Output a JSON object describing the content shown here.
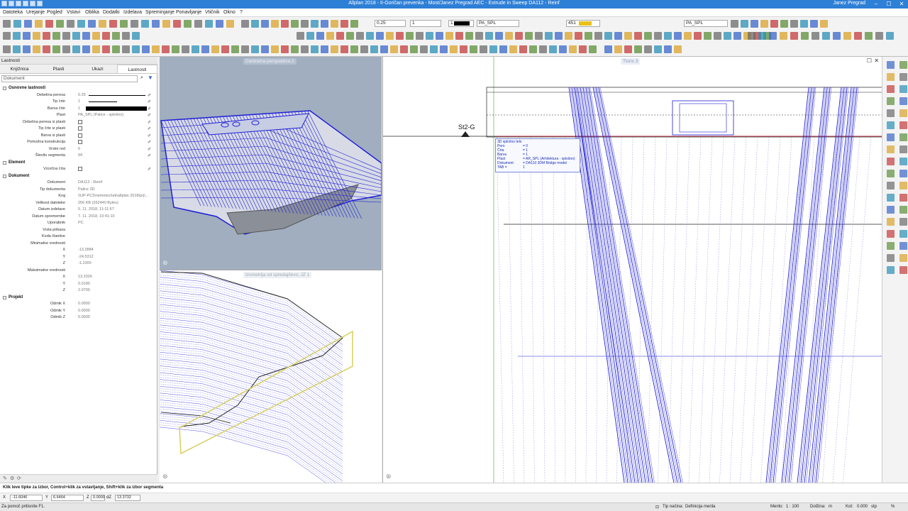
{
  "window": {
    "title": "Allplan 2018 - II-Goričan prevenka - Most/Janez Pregrad AEC - Extrude in Sweep DA112 - Reinf",
    "user": "Janez Pregrad",
    "min_glyph": "–",
    "max_glyph": "☐",
    "close_glyph": "✕"
  },
  "menu": [
    "Datoteka",
    "Urejanje",
    "Pogled",
    "Vstavi",
    "Oblika",
    "Dodatki",
    "Izdelava",
    "Spreminjanje",
    "Ponavljanje",
    "Vtičnik",
    "Okno",
    "?"
  ],
  "toolbar": {
    "pen_value": "0.25",
    "line_value": "1",
    "color_value": "1",
    "layer_value": "PA_SPL",
    "segment_value": "451",
    "layer2_value": "PA_SPL"
  },
  "panel": {
    "title": "Lastnosti",
    "tabs": [
      "Knjižnica",
      "Plasti",
      "Ukazi",
      "Lastnosti"
    ],
    "active_tab": "Lastnosti",
    "doc_combo": "Dokument",
    "sections": {
      "basic": "Osnovne lastnosti",
      "element": "Element",
      "document": "Dokument",
      "project": "Projekt"
    },
    "basic_rows": [
      {
        "label": "Debelina peresa",
        "value": "0.25"
      },
      {
        "label": "Tip črte",
        "value": "1"
      },
      {
        "label": "Barva črte",
        "value": "1"
      },
      {
        "label": "Plast",
        "value": "PA_SPL (Palice - splošno)"
      },
      {
        "label": "Debelina peresa iz plasti",
        "value": ""
      },
      {
        "label": "Tip črte iz plasti",
        "value": ""
      },
      {
        "label": "Barva iz plasti",
        "value": ""
      },
      {
        "label": "Pomožna konstrukcija",
        "value": ""
      },
      {
        "label": "Vrstni red",
        "value": "0"
      },
      {
        "label": "Število segmenta",
        "value": "94"
      }
    ],
    "element_rows": [
      {
        "label": "Vzorčna črta",
        "value": ""
      }
    ],
    "document_rows": [
      {
        "label": "Dokument",
        "value": "DA112 - Reinf"
      },
      {
        "label": "Tip dokumenta",
        "value": "Palice 3D"
      },
      {
        "label": "Kraj",
        "value": "\\\\UP-PC3\\nemetschek\\allplan 2018\\prj\\..."
      },
      {
        "label": "Velikost datoteke",
        "value": "256 KB (262440 Bytes)"
      },
      {
        "label": "Datum izdelave",
        "value": "5. 11. 2018, 11:11:57"
      },
      {
        "label": "Datum spremembe",
        "value": "7. 11. 2018, 10:41:10"
      },
      {
        "label": "Uporabnik",
        "value": "PC"
      },
      {
        "label": "Vrsta prikaza",
        "value": ""
      },
      {
        "label": "Koda članitve",
        "value": ""
      },
      {
        "label": "Minimalne vrednosti",
        "value": ""
      },
      {
        "label": "X",
        "value": "-13.2884"
      },
      {
        "label": "Y",
        "value": "-24.5312"
      },
      {
        "label": "Z",
        "value": "-1.1000"
      },
      {
        "label": "Maksimalne vrednosti",
        "value": ""
      },
      {
        "label": "X",
        "value": "13.2026"
      },
      {
        "label": "Y",
        "value": "0.0180"
      },
      {
        "label": "Z",
        "value": "2.0700"
      }
    ],
    "project_rows": [
      {
        "label": "Odmik X",
        "value": "0.0000"
      },
      {
        "label": "Odmik Y",
        "value": "0.0000"
      },
      {
        "label": "Odmik Z",
        "value": "0.0000"
      }
    ]
  },
  "viewports": {
    "top_left_title": "Centralna perspektiva 2",
    "bottom_left_title": "Izometrija od spredaj/levo, JZ 1",
    "right_title": "Tloris 3",
    "section_label": "St2-G"
  },
  "tooltip": {
    "title": "3D splošno telo",
    "rows": [
      {
        "k": "Pero",
        "v": "= 0"
      },
      {
        "k": "Črta",
        "v": "= 1"
      },
      {
        "k": "Barva",
        "v": "= 1"
      },
      {
        "k": "Plast",
        "v": "= AR_SPL (Arhitektura - splošno)"
      },
      {
        "k": "Dokument",
        "v": "= DA110 3DM Bridge model"
      },
      {
        "k": "TAB =",
        "v": "1"
      }
    ]
  },
  "status": {
    "prompt": "Klik leve tipke za izbor, Control+klik za vstavljanje, Shift+klik za izbor segmenta",
    "x_label": "X",
    "x_value": "-11.6046",
    "y_label": "Y",
    "y_value": "6.6464",
    "z_label": "Z",
    "z_value": "0.0000",
    "dz_label": "dZ",
    "dz_value": "13.3732",
    "help": "Za pomoč pritisnite F1.",
    "snap_label": "Tip načina:",
    "snap_value": "Definicija merila",
    "scale_label": "Merilo:",
    "scale_value": "1 : 100",
    "length_label": "Dolžina:",
    "length_value": "m",
    "angle_label": "Kot:",
    "angle_value": "0.000",
    "angle_unit": "stp",
    "percent": "%"
  },
  "colors": {
    "titlebar": "#2e7fd6",
    "wire": "#1f1fd6",
    "accent": "#e8d73a"
  }
}
